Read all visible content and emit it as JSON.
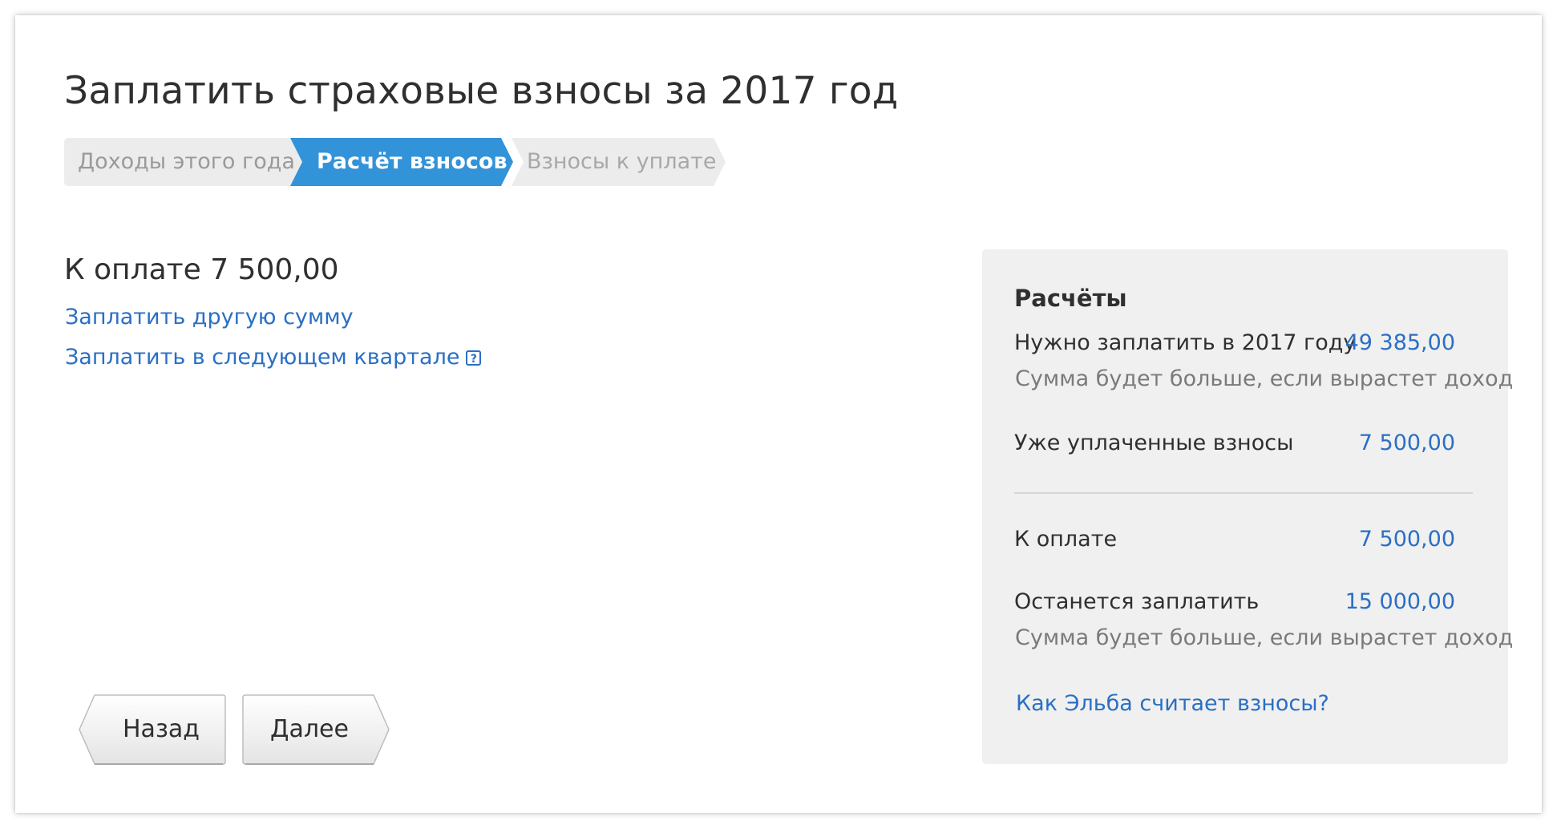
{
  "page": {
    "title": "Заплатить страховые взносы за 2017 год"
  },
  "stepper": {
    "steps": [
      {
        "label": "Доходы этого года",
        "state": "done"
      },
      {
        "label": "Расчёт взносов",
        "state": "active"
      },
      {
        "label": "Взносы к уплате",
        "state": "upcoming"
      }
    ]
  },
  "main": {
    "amount_text": "К оплате 7 500,00",
    "pay_other_link": "Заплатить другую сумму",
    "pay_next_quarter_link": "Заплатить в следующем квартале",
    "help_icon_glyph": "?"
  },
  "buttons": {
    "back_label": "Назад",
    "next_label": "Далее"
  },
  "calculations": {
    "title": "Расчёты",
    "rows": [
      {
        "label": "Нужно заплатить в 2017 году",
        "value": "49 385,00",
        "hint": "Сумма будет больше, если вырастет доход"
      },
      {
        "label": "Уже уплаченные взносы",
        "value": "7 500,00"
      },
      {
        "label": "К оплате",
        "value": "7 500,00"
      },
      {
        "label": "Останется заплатить",
        "value": "15 000,00",
        "hint": "Сумма будет больше, если вырастет доход"
      }
    ],
    "how_link": "Как Эльба считает взносы?"
  },
  "colors": {
    "accent": "#3393d8",
    "link": "#2a6fc4",
    "step_inactive": "#ececec",
    "panel_bg": "#f0f0f0",
    "text": "#2f2f2f",
    "muted": "#7a7a7a"
  },
  "icons": {
    "help": "question-square-icon"
  }
}
